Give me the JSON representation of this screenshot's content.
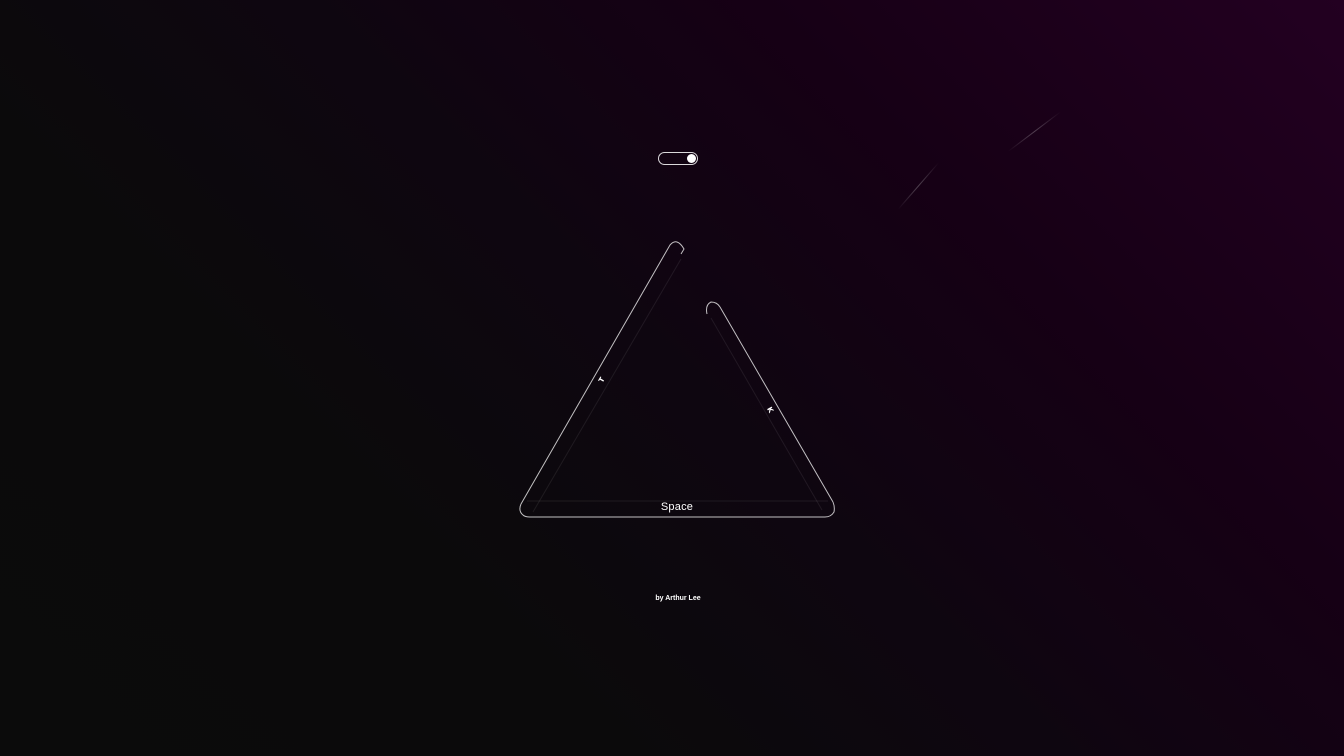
{
  "game": {
    "toggle": {
      "state": "on"
    },
    "keys": {
      "left": {
        "label": "T"
      },
      "right": {
        "label": "K"
      },
      "bottom": {
        "label": "Space"
      }
    },
    "credit": "by Arthur Lee"
  },
  "colors": {
    "background_dark": "#0b0b0b",
    "background_accent": "#230021",
    "outline": "#ffffff"
  }
}
